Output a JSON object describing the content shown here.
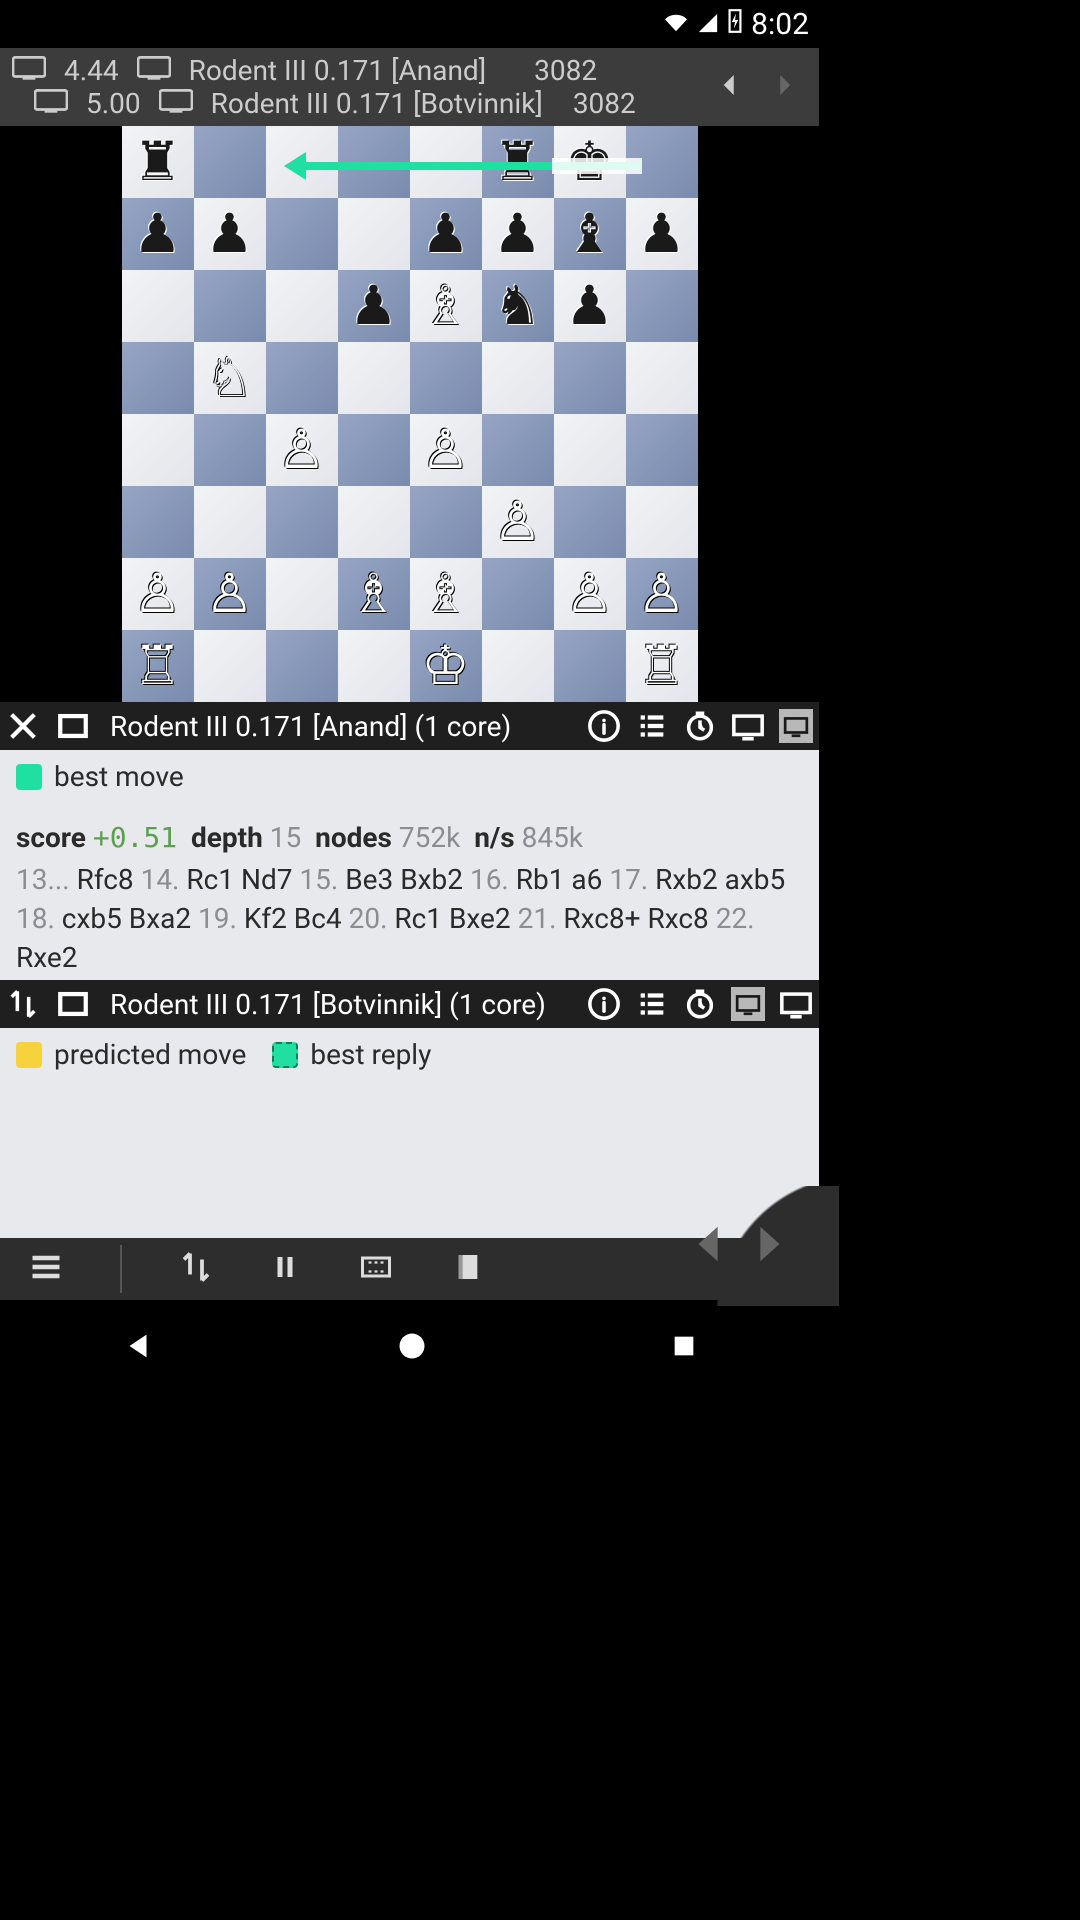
{
  "status": {
    "time": "8:02"
  },
  "header": {
    "p1_time": "4.44",
    "p1_name": "Rodent III 0.171 [Anand]",
    "p1_rating": "3082",
    "p2_time": "5.00",
    "p2_name": "Rodent III 0.171 [Botvinnik]",
    "p2_rating": "3082"
  },
  "board": {
    "orientation": "white-bottom",
    "last_move_arrow": {
      "from": "f8",
      "to": "c8"
    },
    "rows": [
      [
        "br",
        "",
        "",
        "",
        "",
        "br",
        "bk",
        ""
      ],
      [
        "bp",
        "bp",
        "",
        "",
        "bp",
        "bp",
        "bb",
        "bp"
      ],
      [
        "",
        "",
        "",
        "bp",
        "wb",
        "bn",
        "bp",
        ""
      ],
      [
        "",
        "wn",
        "",
        "",
        "",
        "",
        "",
        ""
      ],
      [
        "",
        "",
        "wp",
        "",
        "wp",
        "",
        "",
        ""
      ],
      [
        "",
        "",
        "",
        "",
        "",
        "wp",
        "",
        ""
      ],
      [
        "wp",
        "wp",
        "",
        "wb",
        "wb",
        "",
        "wp",
        "wp"
      ],
      [
        "wr",
        "",
        "",
        "",
        "wk",
        "",
        "",
        "wr"
      ]
    ]
  },
  "engine1": {
    "title": "Rodent III 0.171 [Anand] (1 core)",
    "legend_best": "best move",
    "score_label": "score",
    "score_value": "+0.51",
    "depth_label": "depth",
    "depth_value": "15",
    "nodes_label": "nodes",
    "nodes_value": "752k",
    "nps_label": "n/s",
    "nps_value": "845k",
    "pv": [
      {
        "n": "13...",
        "m": "Rfc8"
      },
      {
        "n": "14.",
        "m": "Rc1 Nd7"
      },
      {
        "n": "15.",
        "m": "Be3 Bxb2"
      },
      {
        "n": "16.",
        "m": "Rb1 a6"
      },
      {
        "n": "17.",
        "m": "Rxb2 axb5"
      },
      {
        "n": "18.",
        "m": "cxb5 Bxa2"
      },
      {
        "n": "19.",
        "m": "Kf2 Bc4"
      },
      {
        "n": "20.",
        "m": "Rc1 Bxe2"
      },
      {
        "n": "21.",
        "m": "Rxc8+ Rxc8"
      },
      {
        "n": "22.",
        "m": "Rxe2"
      }
    ]
  },
  "engine2": {
    "title": "Rodent III 0.171 [Botvinnik] (1 core)",
    "legend_predicted": "predicted move",
    "legend_reply": "best reply"
  },
  "pieces": {
    "wk": "♔",
    "wq": "♕",
    "wr": "♖",
    "wb": "♗",
    "wn": "♘",
    "wp": "♙",
    "bk": "♚",
    "bq": "♛",
    "br": "♜",
    "bb": "♝",
    "bn": "♞",
    "bp": "♟"
  }
}
